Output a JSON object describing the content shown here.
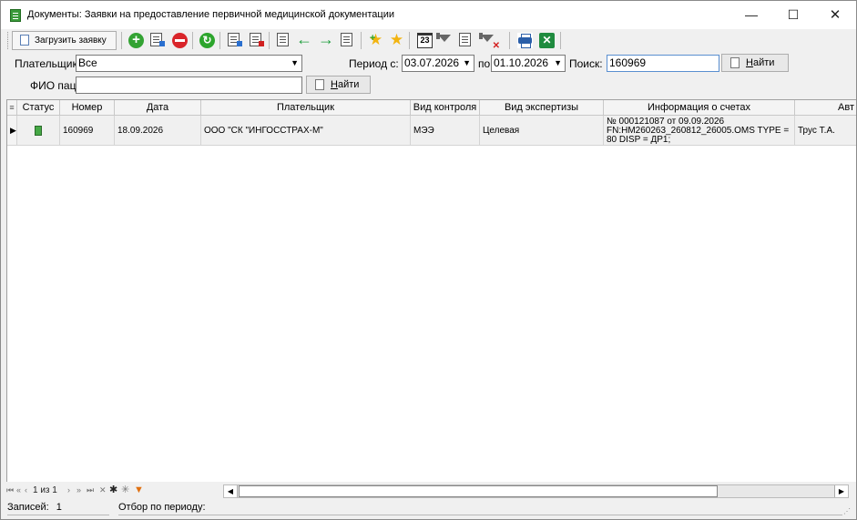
{
  "window": {
    "title": "Документы: Заявки на предоставление первичной медицинской документации",
    "minimize": "—",
    "maximize": "☐",
    "close": "✕"
  },
  "toolbar": {
    "load_button_label": "Загрузить заявку",
    "icons": [
      "add-icon",
      "edit-doc-icon",
      "delete-icon",
      "refresh-icon",
      "doc-edit-blue-icon",
      "doc-delete-icon",
      "doc-export-icon",
      "arrow-left-icon",
      "arrow-right-icon",
      "doc-import-icon",
      "star-add-icon",
      "star-icon",
      "calendar-icon",
      "filter-icon",
      "filter-edit-icon",
      "filter-clear-icon",
      "print-icon",
      "excel-icon"
    ],
    "calendar_glyph": "23"
  },
  "filters": {
    "payer_label": "Плательщик:",
    "payer_value": "Все",
    "period_from_label": "Период с:",
    "period_from_value": "03.07.2026",
    "period_to_label": "по",
    "period_to_value": "01.10.2026",
    "search_label": "Поиск:",
    "search_value": "160969",
    "find_button_prefix": "Н",
    "find_button_rest": "айти",
    "fio_label": "ФИО пац.:",
    "fio_value": ""
  },
  "grid": {
    "columns": [
      "Статус",
      "Номер",
      "Дата",
      "Плательщик",
      "Вид контроля",
      "Вид экспертизы",
      "Информация о счетах",
      "Авт"
    ],
    "rows": [
      {
        "number": "160969",
        "date": "18.09.2026",
        "payer": "ООО \"СК \"ИНГОССТРАХ-М\"",
        "control": "МЭЭ",
        "expertise": "Целевая",
        "info": "№ 000121087 от 09.09.2026 FN:HM260263_260812_26005.OMS TYPE = 80 DISP = ДР1;",
        "author": "Трус Т.А."
      }
    ]
  },
  "navigator": {
    "page_text": "1 из 1"
  },
  "statusbar": {
    "records_label": "Записей:",
    "records_count": "1",
    "period_filter_label": "Отбор по периоду:"
  }
}
